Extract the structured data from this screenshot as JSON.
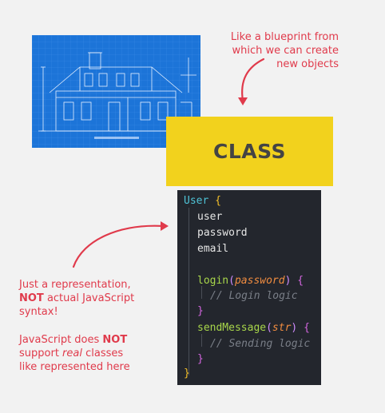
{
  "caption_top": [
    "Like a blueprint from",
    "which we can create",
    "new objects"
  ],
  "class_label": "CLASS",
  "code": {
    "class_name": "User",
    "open_brace": "{",
    "close_brace": "}",
    "props": [
      "user",
      "password",
      "email"
    ],
    "method1": {
      "name": "login",
      "param": "password",
      "comment": "// Login logic"
    },
    "method2": {
      "name": "sendMessage",
      "param": "str",
      "comment": "// Sending logic"
    }
  },
  "note1": [
    "Just a representation,",
    "NOT",
    " actual JavaScript",
    "syntax!"
  ],
  "note2": [
    "JavaScript does ",
    "NOT",
    "support ",
    "real",
    " classes",
    "like represented here"
  ],
  "colors": {
    "accent": "#e03a4b",
    "class_box": "#f2d21d",
    "blueprint": "#1c74d8",
    "code_bg": "#23262d"
  }
}
